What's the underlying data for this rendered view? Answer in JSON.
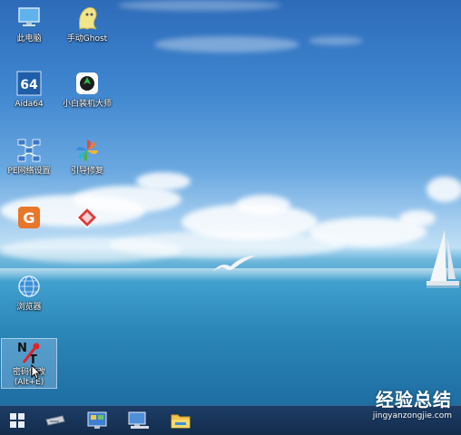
{
  "desktop": {
    "icons": [
      {
        "name": "this-pc",
        "label": "此电脑"
      },
      {
        "name": "manual-ghost",
        "label": "手动Ghost"
      },
      {
        "name": "aida64",
        "label": "Aida64",
        "glyph": "64"
      },
      {
        "name": "xiaobai-installer",
        "label": "小白装机大师"
      },
      {
        "name": "pe-network-settings",
        "label": "PE网络设置"
      },
      {
        "name": "boot-repair",
        "label": "引导修复"
      },
      {
        "name": "partition-tool",
        "label": "",
        "glyph": "G"
      },
      {
        "name": "red-diamond-tool",
        "label": ""
      },
      {
        "name": "browser",
        "label": "浏览器"
      },
      {
        "name": "password-reset",
        "label": "密码修改",
        "sublabel": "(Alt+E)"
      }
    ]
  },
  "taskbar": {
    "items": [
      {
        "name": "start-icon"
      },
      {
        "name": "drive-icon"
      },
      {
        "name": "control-panel-icon"
      },
      {
        "name": "network-computer-icon"
      },
      {
        "name": "file-explorer-icon"
      }
    ]
  },
  "watermark": {
    "title": "经验总结",
    "url": "jingyanzongjie.com"
  },
  "colors": {
    "sky_top": "#2d6bb9",
    "sea": "#2b86b8",
    "taskbar": "#132c4c",
    "watermark_red": "#d9342b"
  }
}
